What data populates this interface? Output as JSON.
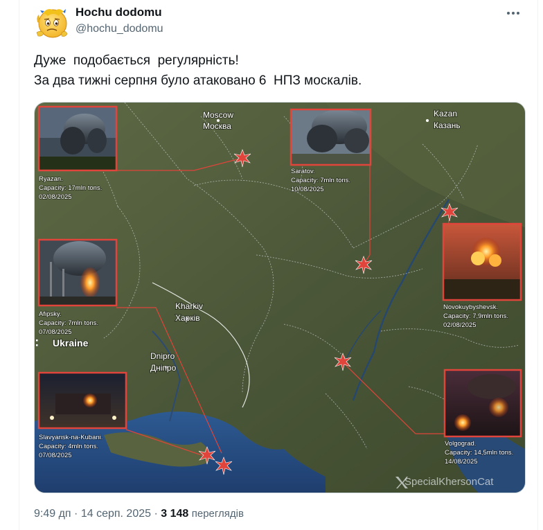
{
  "post": {
    "author": {
      "display_name": "Hochu dodomu",
      "handle": "@hochu_dodomu",
      "avatar_icon": "emoji-face-avatar"
    },
    "text_lines": [
      "Дуже  подобається  регулярність!",
      "За два тижні серпня було атаковано 6  НПЗ москалів."
    ],
    "meta": {
      "time": "9:49 дп",
      "separator": "·",
      "date": "14 серп. 2025",
      "views_count": "3 148",
      "views_label": "переглядів"
    }
  },
  "map": {
    "cities": {
      "moscow_en": "Moscow",
      "moscow_ru": "Москва",
      "kazan_en": "Kazan",
      "kazan_ru": "Казань",
      "kharkiv_en": "Kharkiv",
      "kharkiv_ua": "Харків",
      "dnipro_en": "Dnipro",
      "dnipro_ua": "Дніпро",
      "ukraine": "Ukraine"
    },
    "targets": [
      {
        "name": "Ryazan.",
        "capacity": "Capacity: 17mln tons.",
        "date": "02/08/2025"
      },
      {
        "name": "Saratov.",
        "capacity": "Capacity: 7mln tons.",
        "date": "10/08/2025"
      },
      {
        "name": "Novokuybyshevsk.",
        "capacity": "Capacity: 7,9mln tons.",
        "date": "02/08/2025"
      },
      {
        "name": "Afipsky.",
        "capacity": "Capacity: 7mln tons.",
        "date": "07/08/2025"
      },
      {
        "name": "Slavyansk-na-Kubani.",
        "capacity": "Capacity: 4mln tons.",
        "date": "07/08/2025"
      },
      {
        "name": "Volgograd.",
        "capacity": "Capacity: 14,5mln tons.",
        "date": "14/08/2025"
      }
    ],
    "watermark": "SpecialKhersonCat",
    "colors": {
      "accent": "#e0443a",
      "land": "#4e5a3b",
      "sea": "#2a4f86"
    }
  }
}
